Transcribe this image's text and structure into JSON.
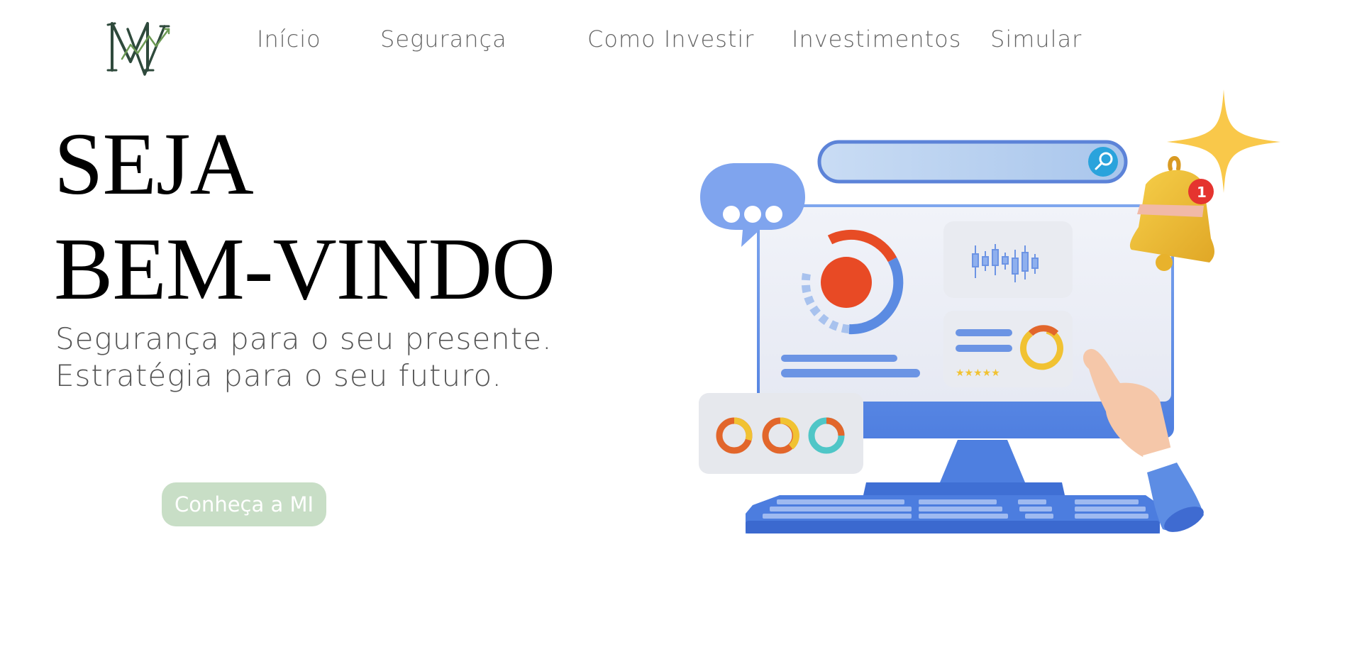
{
  "brand": {
    "logo_text": "MI",
    "logo_color": "#2f4a3c",
    "accent_color": "#6c9a54"
  },
  "nav": {
    "items": [
      {
        "label": "Início"
      },
      {
        "label": "Segurança"
      },
      {
        "label": "Como Investir"
      },
      {
        "label": "Investimentos"
      },
      {
        "label": "Simular"
      }
    ]
  },
  "hero": {
    "title_line1": "SEJA",
    "title_line2": "BEM-VINDO",
    "subtitle_line1": "Segurança para o seu presente.",
    "subtitle_line2": "Estratégia para o seu futuro.",
    "cta_label": "Conheça a MI",
    "cta_color": "#c8dec6"
  },
  "illustration": {
    "notification_count": "1",
    "rating_stars": "★★★★★",
    "icons": [
      "speech-bubble-icon",
      "magnifier-icon",
      "bell-icon",
      "sparkle-icon",
      "candlestick-icon",
      "donut-icon",
      "hand-pointer-icon",
      "keyboard-icon"
    ]
  }
}
